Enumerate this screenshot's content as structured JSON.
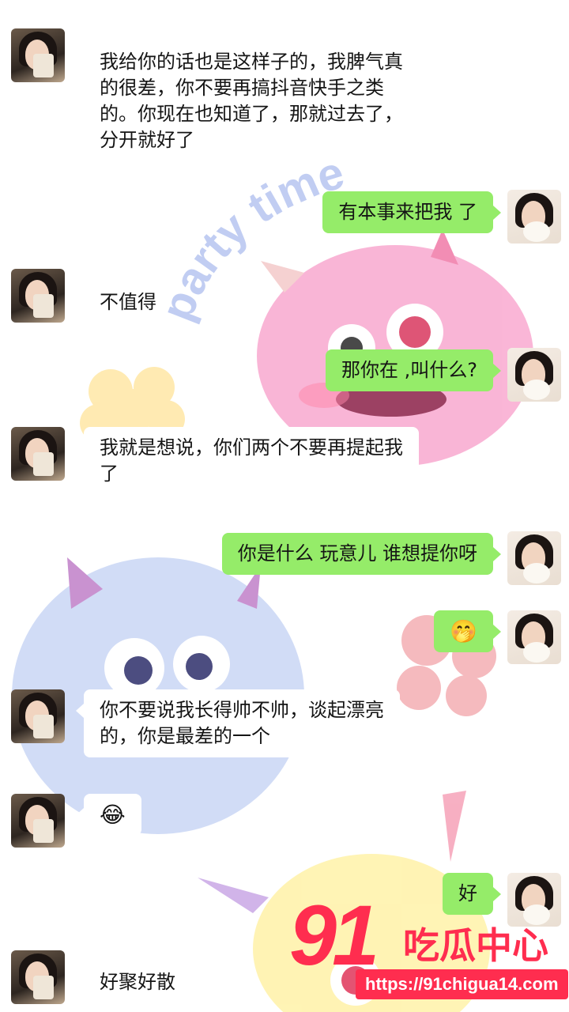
{
  "chat": {
    "messages": [
      {
        "side": "left",
        "lines": [
          "我给你的话也是这样子的，我脾气真",
          "的很差，你不要再搞抖音快手之类",
          "的。你现在也知道了，那就过去了，",
          "分开就好了"
        ]
      },
      {
        "side": "right",
        "lines": [
          "有本事来把我 了"
        ]
      },
      {
        "side": "left",
        "lines": [
          "不值得"
        ]
      },
      {
        "side": "right",
        "lines": [
          "那你在 ,叫什么?"
        ]
      },
      {
        "side": "left",
        "lines": [
          "我就是想说，你们两个不要再提起我",
          "了"
        ]
      },
      {
        "side": "right",
        "lines": [
          "你是什么 玩意儿 谁想提你呀"
        ]
      },
      {
        "side": "right",
        "emoji": "🤭"
      },
      {
        "side": "left",
        "lines": [
          "你不要说我长得帅不帅，谈起漂亮",
          "的，你是最差的一个"
        ]
      },
      {
        "side": "left",
        "emoji": "😂"
      },
      {
        "side": "right",
        "lines": [
          "好"
        ]
      },
      {
        "side": "left",
        "lines": [
          "好聚好散"
        ]
      }
    ]
  },
  "wallpaper": {
    "text": "party time"
  },
  "watermark": {
    "logo_number": "91",
    "logo_text": "吃瓜中心",
    "url": "https://91chigua14.com"
  },
  "colors": {
    "bubble_right": "#95ec69",
    "bubble_left": "#ffffff",
    "watermark": "#ff2d4f"
  }
}
